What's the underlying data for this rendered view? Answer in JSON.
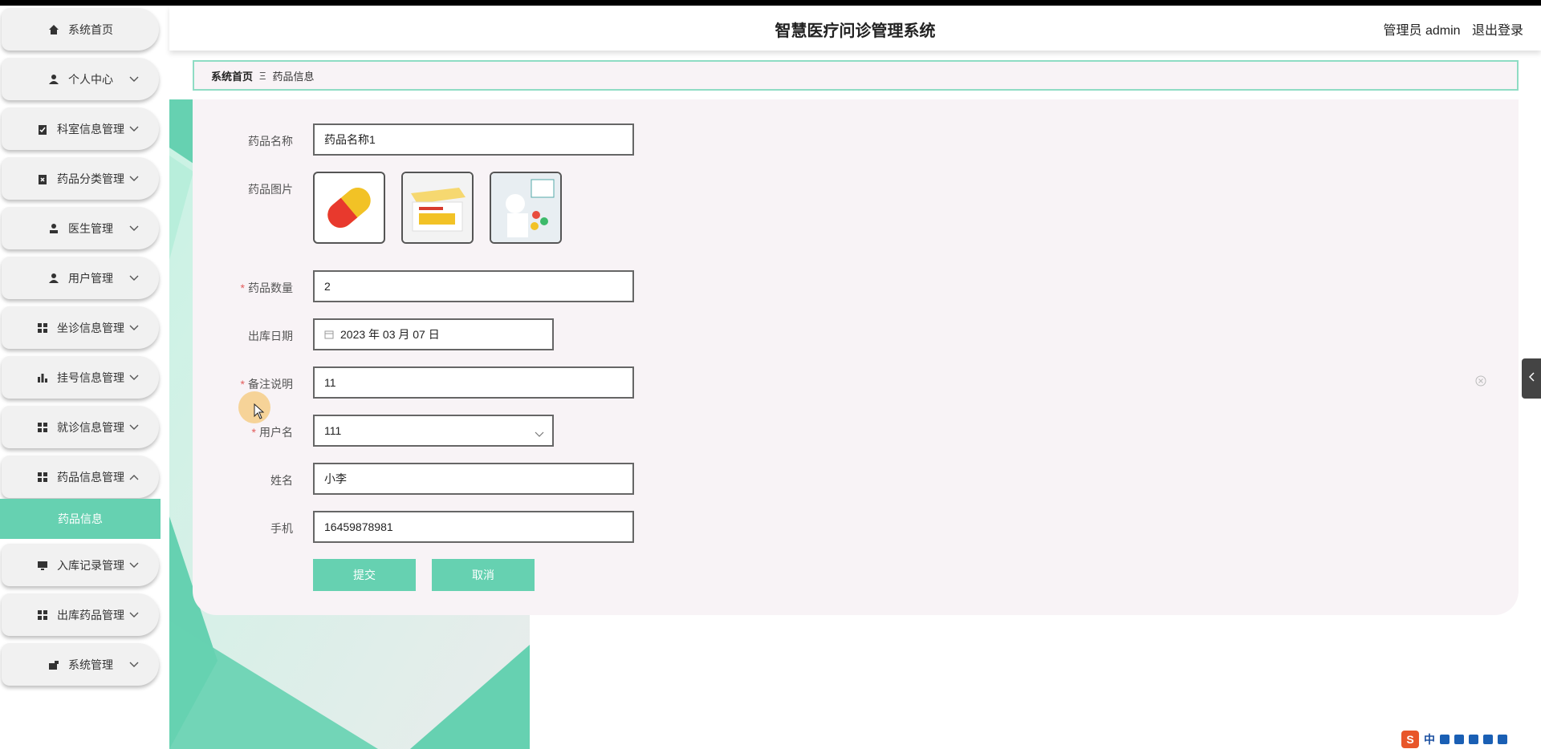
{
  "header": {
    "title": "智慧医疗问诊管理系统",
    "user_label": "管理员 admin",
    "logout": "退出登录"
  },
  "sidebar": {
    "items": [
      {
        "label": "系统首页",
        "icon": "home-icon"
      },
      {
        "label": "个人中心",
        "icon": "person-icon"
      },
      {
        "label": "科室信息管理",
        "icon": "clipboard-check-icon"
      },
      {
        "label": "药品分类管理",
        "icon": "clipboard-x-icon"
      },
      {
        "label": "医生管理",
        "icon": "doctor-icon"
      },
      {
        "label": "用户管理",
        "icon": "person-icon"
      },
      {
        "label": "坐诊信息管理",
        "icon": "grid-icon"
      },
      {
        "label": "挂号信息管理",
        "icon": "bar-chart-icon"
      },
      {
        "label": "就诊信息管理",
        "icon": "grid-icon"
      },
      {
        "label": "药品信息管理",
        "icon": "grid-icon"
      },
      {
        "label": "入库记录管理",
        "icon": "monitor-icon"
      },
      {
        "label": "出库药品管理",
        "icon": "grid-icon"
      },
      {
        "label": "系统管理",
        "icon": "settings-icon"
      }
    ],
    "active_sub": "药品信息"
  },
  "breadcrumb": {
    "home": "系统首页",
    "separator": "Ξ",
    "current": "药品信息"
  },
  "form": {
    "name_label": "药品名称",
    "name_value": "药品名称1",
    "image_label": "药品图片",
    "images": [
      "pill-capsule-image",
      "medicine-box-image",
      "pharmacy-image"
    ],
    "qty_label": "药品数量",
    "qty_value": "2",
    "date_label": "出库日期",
    "date_value": "2023 年 03 月 07 日",
    "note_label": "备注说明",
    "note_value": "11",
    "username_label": "用户名",
    "username_value": "111",
    "realname_label": "姓名",
    "realname_value": "小李",
    "phone_label": "手机",
    "phone_value": "16459878981",
    "required_mark": "*",
    "submit": "提交",
    "cancel": "取消"
  },
  "tray": {
    "ime_logo": "S",
    "ime_lang": "中"
  },
  "colors": {
    "accent": "#66d1b1",
    "card_bg": "#f8f3f6",
    "required": "#e25c5c"
  }
}
